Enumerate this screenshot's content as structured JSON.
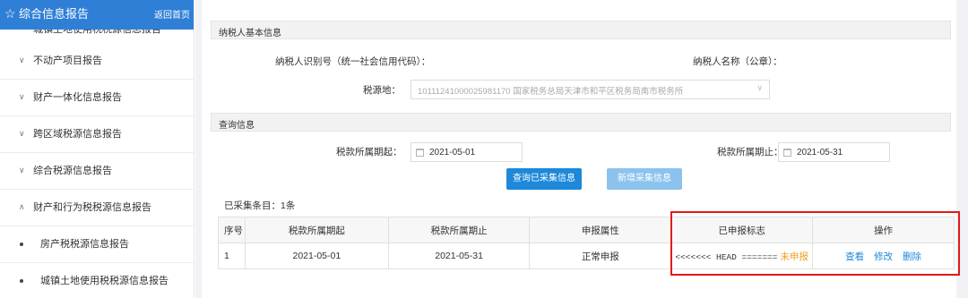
{
  "sidebar": {
    "title": "综合信息报告",
    "home_link": "返回首页",
    "cut_item": "城镇土地使用税税源信息报告",
    "items": [
      {
        "label": "不动产项目报告",
        "chevron": "∨"
      },
      {
        "label": "财产一体化信息报告",
        "chevron": "∨"
      },
      {
        "label": "跨区域税源信息报告",
        "chevron": "∨"
      },
      {
        "label": "综合税源信息报告",
        "chevron": "∨"
      },
      {
        "label": "财产和行为税税源信息报告",
        "chevron": "∧"
      },
      {
        "label": "房产税税源信息报告"
      },
      {
        "label": "城镇土地使用税税源信息报告"
      }
    ]
  },
  "taxpayer": {
    "section_title": "纳税人基本信息",
    "id_label": "纳税人识别号（统一社会信用代码）：",
    "name_label": "纳税人名称（公章）：",
    "source_label": "税源地：",
    "source_value": "10111241000025981170 国家税务总局天津市和平区税务局南市税务所"
  },
  "query": {
    "section_title": "查询信息",
    "start_label": "税款所属期起：",
    "start_value": "2021-05-01",
    "end_label": "税款所属期止：",
    "end_value": "2021-05-31",
    "query_button": "查询已采集信息",
    "add_button": "新增采集信息"
  },
  "results": {
    "count_text": "已采集条目：1条",
    "columns": [
      "序号",
      "税款所属期起",
      "税款所属期止",
      "申报属性",
      "已申报标志",
      "操作"
    ],
    "rows": [
      {
        "seq": "1",
        "start": "2021-05-01",
        "end": "2021-05-31",
        "attr": "正常申报",
        "flag_marker": "<<<<<<< HEAD =======",
        "flag_status": "未申报",
        "actions": [
          "查看",
          "修改",
          "删除"
        ]
      }
    ]
  },
  "colors": {
    "sidebar_header": "#2f7fd6",
    "primary_button": "#1e88d9",
    "secondary_button": "#8cc3ee",
    "unsubmitted": "#f0a020",
    "highlight_box": "#e21a1a"
  }
}
